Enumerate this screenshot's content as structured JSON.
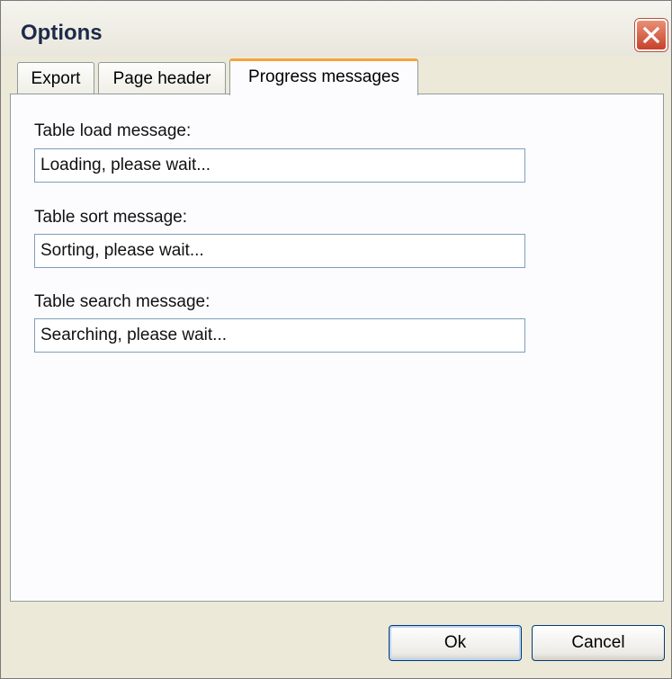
{
  "window": {
    "title": "Options",
    "close_icon": "close-icon"
  },
  "tabs": [
    {
      "label": "Export",
      "active": false
    },
    {
      "label": "Page header",
      "active": false
    },
    {
      "label": "Progress messages",
      "active": true
    }
  ],
  "fields": {
    "load": {
      "label": "Table load message:",
      "value": "Loading, please wait..."
    },
    "sort": {
      "label": "Table sort message:",
      "value": "Sorting, please wait..."
    },
    "search": {
      "label": "Table search message:",
      "value": "Searching, please wait..."
    }
  },
  "buttons": {
    "ok": "Ok",
    "cancel": "Cancel"
  },
  "colors": {
    "active_tab_accent": "#f3a538",
    "close_button": "#c7422a",
    "dialog_background": "#ece9d8"
  }
}
